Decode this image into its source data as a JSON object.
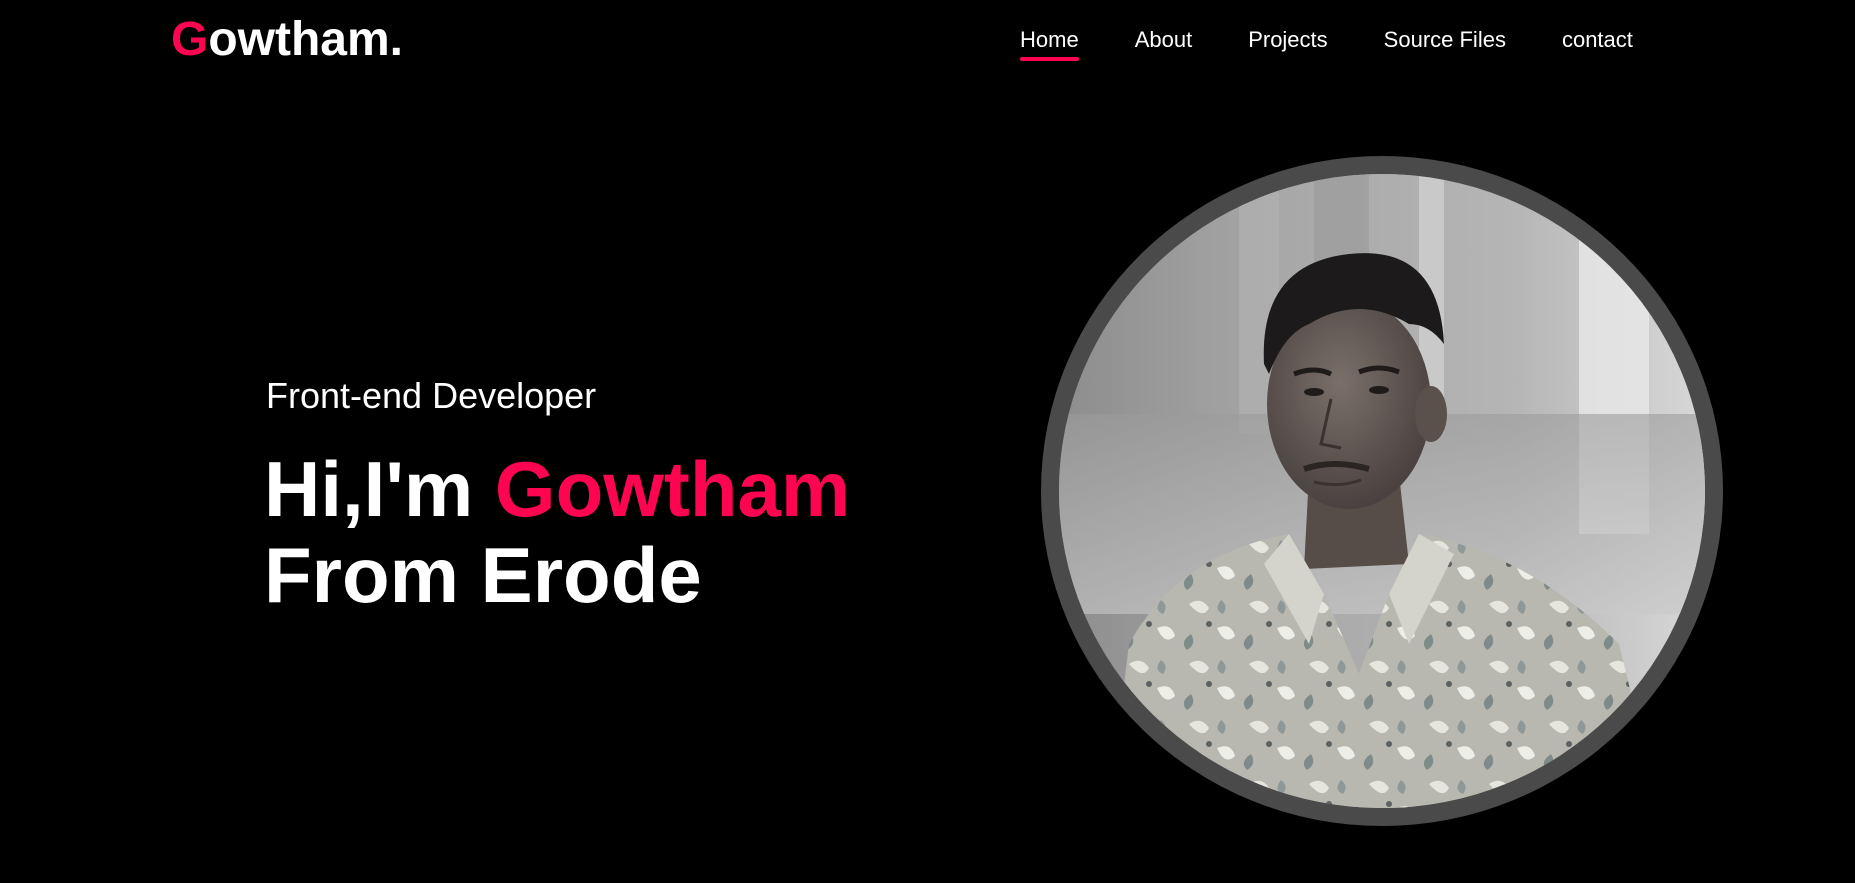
{
  "header": {
    "logo_initial": "G",
    "logo_rest": "owtham."
  },
  "nav": {
    "items": [
      {
        "label": "Home",
        "active": true
      },
      {
        "label": "About",
        "active": false
      },
      {
        "label": "Projects",
        "active": false
      },
      {
        "label": "Source Files",
        "active": false
      },
      {
        "label": "contact",
        "active": false
      }
    ]
  },
  "hero": {
    "role": "Front-end Developer",
    "greeting": "Hi,I'm ",
    "name": "Gowtham",
    "origin": "From Erode"
  },
  "portrait": {
    "description_icon": "profile-photo"
  },
  "colors": {
    "background": "#000000",
    "accent": "#ff0450",
    "text": "#ffffff",
    "ring": "#4a4a4a"
  }
}
